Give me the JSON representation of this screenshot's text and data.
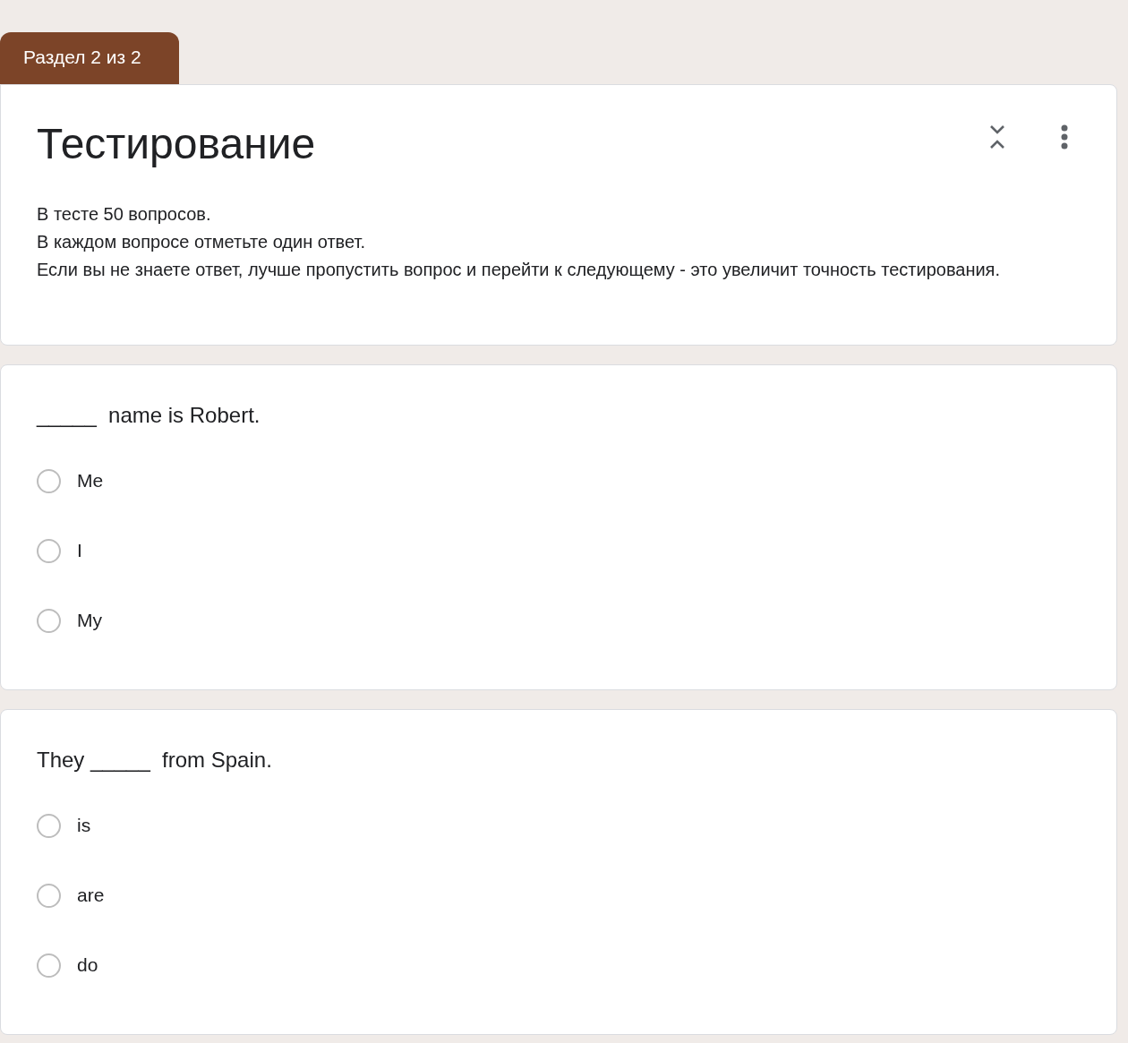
{
  "section_tab": "Раздел 2 из 2",
  "header": {
    "title": "Тестирование",
    "description": [
      "В тесте 50 вопросов.",
      "В каждом вопросе отметьте один ответ.",
      "Если вы не знаете ответ, лучше пропустить вопрос и перейти к следующему - это увеличит точность тестирования."
    ]
  },
  "questions": [
    {
      "text": "_____  name is Robert.",
      "options": [
        {
          "label": "Me",
          "selected": false
        },
        {
          "label": "I",
          "selected": false
        },
        {
          "label": "My",
          "selected": false
        }
      ]
    },
    {
      "text": "They _____  from Spain.",
      "options": [
        {
          "label": "is",
          "selected": false
        },
        {
          "label": "are",
          "selected": false
        },
        {
          "label": "do",
          "selected": false
        }
      ]
    }
  ]
}
